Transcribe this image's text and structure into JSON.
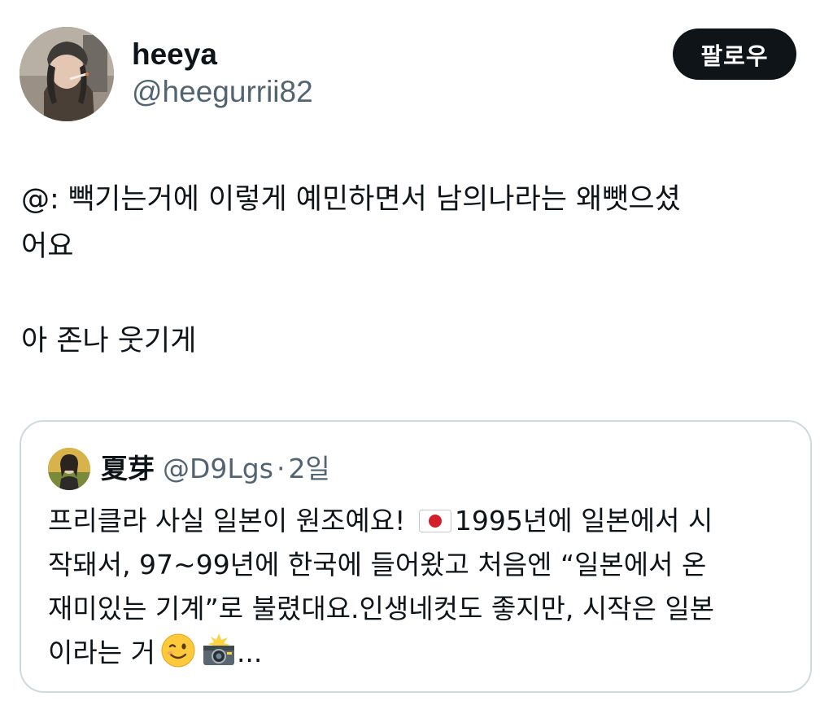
{
  "author": {
    "display_name": "heeya",
    "handle": "@heegurrii82",
    "avatar_icon": "profile-photo"
  },
  "follow_button": {
    "label": "팔로우"
  },
  "tweet": {
    "lines": [
      "@: 빽기는거에 이렇게 예민하면서 남의나라는 왜뺏으셨",
      "어요",
      "아 존나 웃기게"
    ]
  },
  "quoted": {
    "display_name": "夏芽",
    "handle": "@D9Lgs",
    "separator": "·",
    "time": "2일",
    "text_lines": [
      {
        "before_flag": "프리클라 사실 일본이 원조예요! ",
        "flag": "japan-flag-icon",
        "after_flag": "1995년에 일본에서 시"
      },
      {
        "text": "작돼서, 97~99년에 한국에 들어왔고 처음엔 “일본에서 온"
      },
      {
        "text": "재미있는 기계”로 불렸대요.인생네컷도 좋지만, 시작은 일본"
      },
      {
        "text": "이라는 거",
        "ellipsis": "..."
      }
    ],
    "emojis": [
      "wink-icon",
      "camera-flash-icon"
    ]
  },
  "colors": {
    "text_primary": "#0f1419",
    "text_secondary": "#536471",
    "border": "#cfd9de",
    "button_bg": "#0f1419",
    "button_text": "#ffffff"
  }
}
